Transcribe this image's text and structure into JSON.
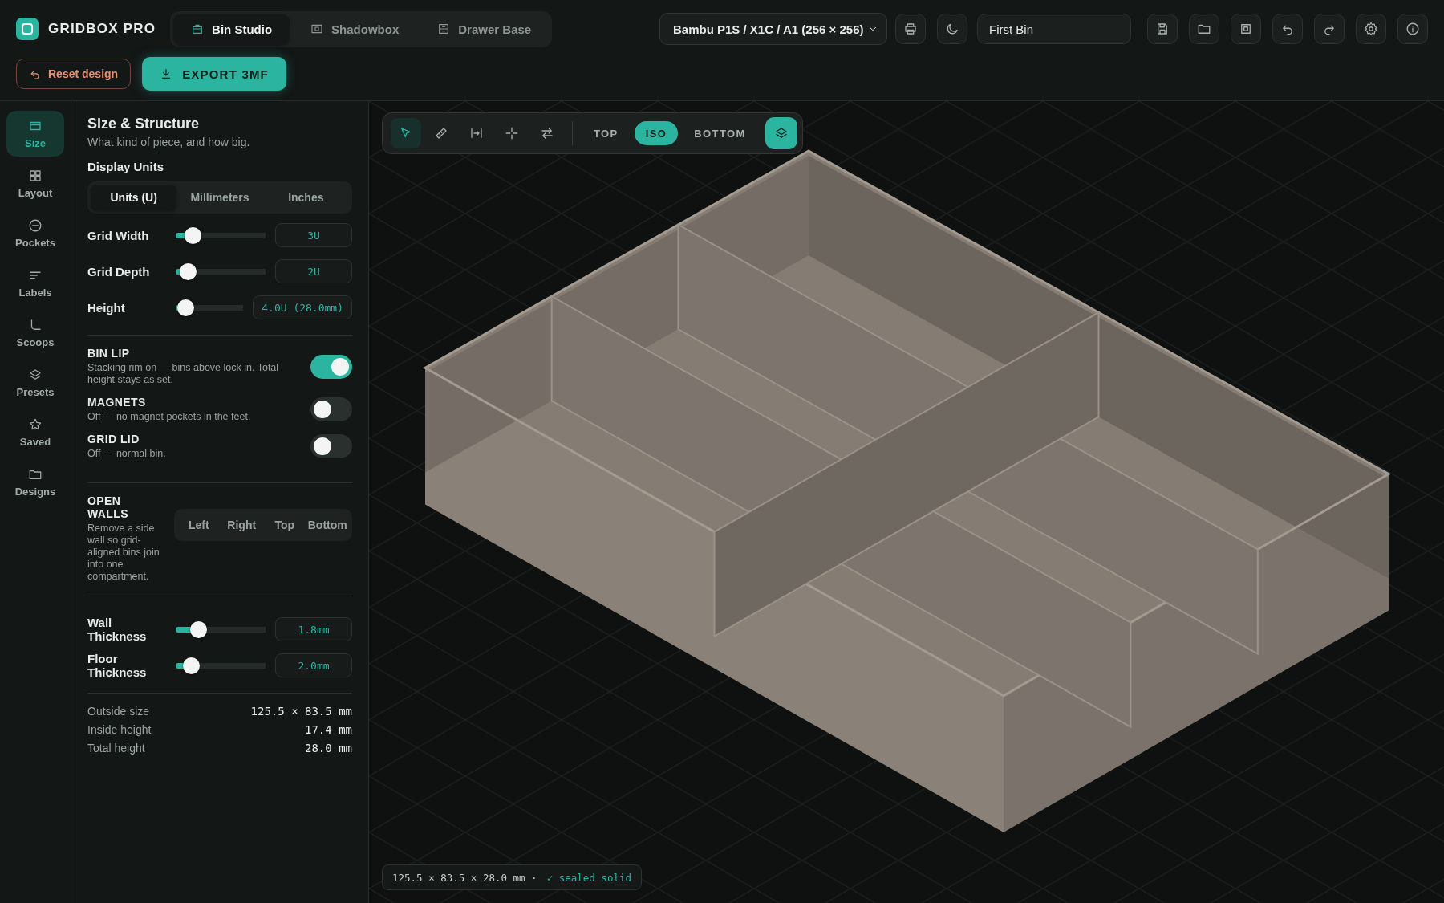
{
  "header": {
    "logo": "GRIDBOX PRO",
    "modes": [
      {
        "label": "Bin Studio",
        "selected": true
      },
      {
        "label": "Shadowbox",
        "selected": false
      },
      {
        "label": "Drawer Base",
        "selected": false
      }
    ],
    "printer": "Bambu P1S / X1C / A1 (256 × 256)",
    "design_name": "First Bin",
    "reset": "Reset design",
    "export": "EXPORT 3MF"
  },
  "rail": [
    {
      "label": "Size",
      "selected": true
    },
    {
      "label": "Layout",
      "selected": false
    },
    {
      "label": "Pockets",
      "selected": false
    },
    {
      "label": "Labels",
      "selected": false
    },
    {
      "label": "Scoops",
      "selected": false
    },
    {
      "label": "Presets",
      "selected": false
    },
    {
      "label": "Saved",
      "selected": false
    },
    {
      "label": "Designs",
      "selected": false
    }
  ],
  "panel": {
    "title": "Size & Structure",
    "subtitle": "What kind of piece, and how big.",
    "units_label": "Display Units",
    "units": [
      {
        "label": "Units (U)",
        "selected": true
      },
      {
        "label": "Millimeters",
        "selected": false
      },
      {
        "label": "Inches",
        "selected": false
      }
    ],
    "size_sliders": [
      {
        "label": "Grid Width",
        "level": 0.2,
        "value": "3U"
      },
      {
        "label": "Grid Depth",
        "level": 0.14,
        "value": "2U"
      },
      {
        "label": "Height",
        "level": 0.15,
        "value": "4.0U (28.0mm)"
      }
    ],
    "toggles": [
      {
        "title": "BIN LIP",
        "description": "Stacking rim on — bins above lock in. Total height stays as set.",
        "on": true
      },
      {
        "title": "MAGNETS",
        "description": "Off — no magnet pockets in the feet.",
        "on": false
      },
      {
        "title": "GRID LID",
        "description": "Off — normal bin.",
        "on": false
      }
    ],
    "open_walls": {
      "title": "OPEN WALLS",
      "description": "Remove a side wall so grid-aligned bins join into one compartment.",
      "options": [
        {
          "label": "Left",
          "selected": false
        },
        {
          "label": "Right",
          "selected": false
        },
        {
          "label": "Top",
          "selected": false
        },
        {
          "label": "Bottom",
          "selected": false
        }
      ]
    },
    "thickness_sliders": [
      {
        "label": "Wall Thickness",
        "level": 0.26,
        "value": "1.8mm"
      },
      {
        "label": "Floor Thickness",
        "level": 0.18,
        "value": "2.0mm"
      }
    ],
    "stats": [
      {
        "label": "Outside size",
        "value": "125.5 × 83.5 mm"
      },
      {
        "label": "Inside height",
        "value": "17.4 mm"
      },
      {
        "label": "Total height",
        "value": "28.0 mm"
      }
    ]
  },
  "viewport": {
    "tools": [
      {
        "selected": true
      },
      {
        "selected": false
      },
      {
        "selected": false
      },
      {
        "selected": false
      },
      {
        "selected": false
      }
    ],
    "views": [
      {
        "label": "TOP",
        "selected": false
      },
      {
        "label": "ISO",
        "selected": true
      },
      {
        "label": "BOTTOM",
        "selected": false
      }
    ],
    "layers_active": true,
    "status": {
      "dimensions": "125.5 × 83.5 × 28.0 mm ·",
      "check": "✓ sealed solid"
    }
  }
}
